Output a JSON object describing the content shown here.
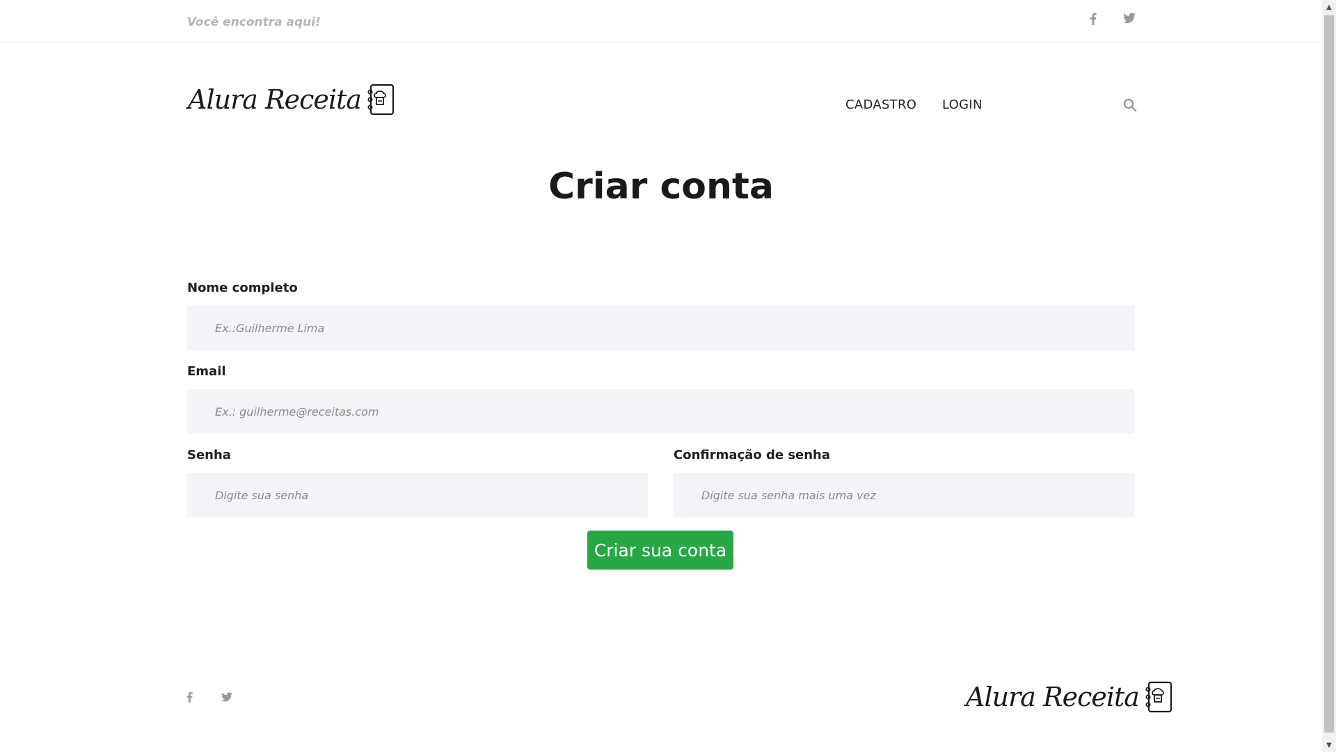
{
  "topbar": {
    "tagline": "Você encontra aqui!",
    "facebook_icon": "f",
    "twitter_icon": "t"
  },
  "header": {
    "logo_text": "Alura Receita",
    "nav": [
      {
        "label": "CADASTRO"
      },
      {
        "label": "LOGIN"
      }
    ]
  },
  "page": {
    "title": "Criar conta"
  },
  "form": {
    "name": {
      "label": "Nome completo",
      "placeholder": "Ex.:Guilherme Lima",
      "value": ""
    },
    "email": {
      "label": "Email",
      "placeholder": "Ex.: guilherme@receitas.com",
      "value": ""
    },
    "password": {
      "label": "Senha",
      "placeholder": "Digite sua senha",
      "value": ""
    },
    "password_confirm": {
      "label": "Confirmação de senha",
      "placeholder": "Digite sua senha mais uma vez",
      "value": ""
    },
    "submit_label": "Criar sua conta"
  },
  "footer": {
    "logo_text": "Alura Receita",
    "facebook_icon": "f",
    "twitter_icon": "t"
  },
  "colors": {
    "accent_green": "#28a745",
    "input_bg": "#f3f4f7",
    "muted_text": "#b5b5b5"
  },
  "icons": [
    "facebook-icon",
    "twitter-icon",
    "search-icon",
    "recipe-book-icon"
  ]
}
